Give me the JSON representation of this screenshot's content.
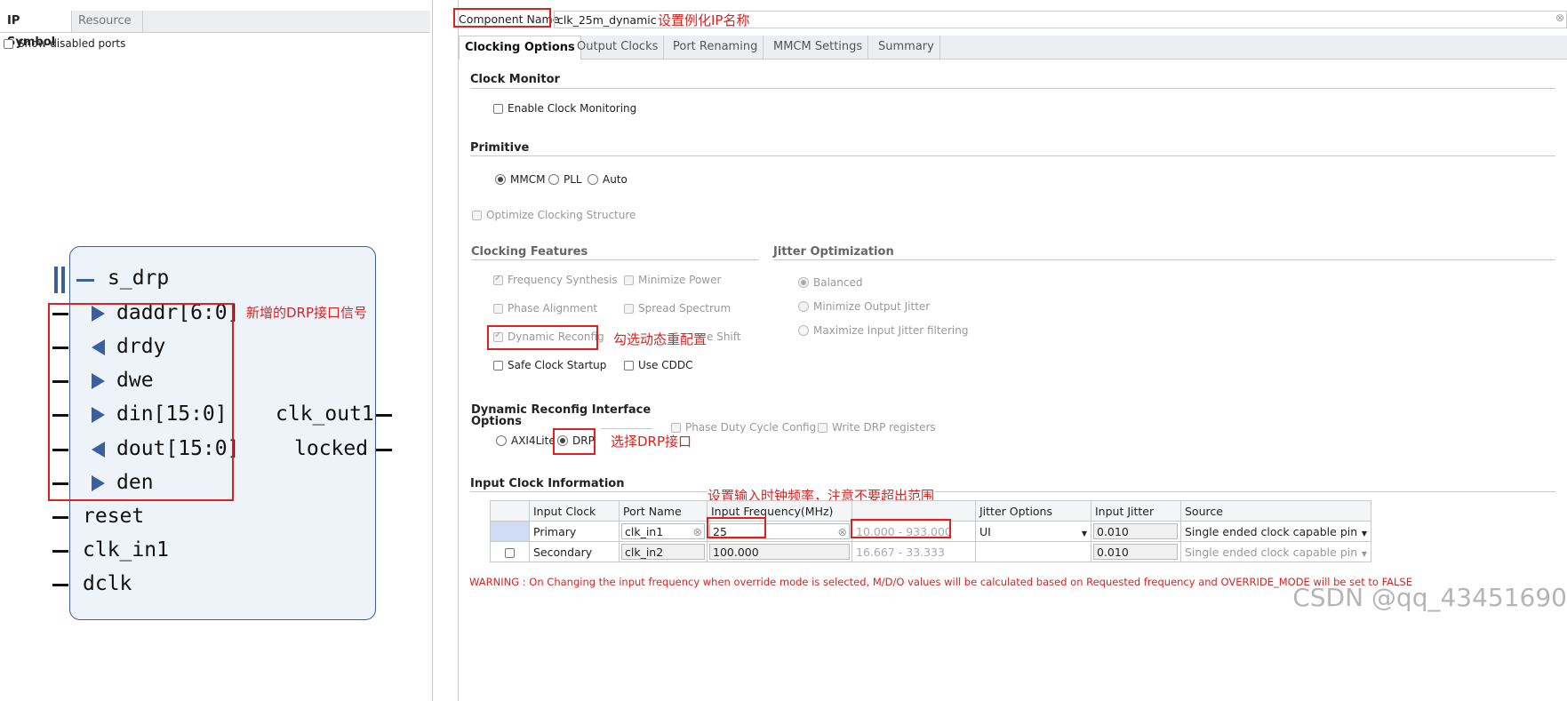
{
  "left_panel": {
    "tabs": [
      "IP Symbol",
      "Resource"
    ],
    "show_disabled_ports": "Show disabled ports",
    "symbol": {
      "bus_port": "s_drp",
      "input_ports": [
        "daddr[6:0]",
        "drdy",
        "dwe",
        "din[15:0]",
        "dout[15:0]",
        "den"
      ],
      "plain_ports": [
        "reset",
        "clk_in1",
        "dclk"
      ],
      "output_ports": [
        "clk_out1",
        "locked"
      ]
    },
    "annotation_drp_signals": "新增的DRP接口信号"
  },
  "component_name": {
    "label": "Component Name",
    "value": "clk_25m_dynamic",
    "annotation": "设置例化IP名称"
  },
  "tabs": [
    "Clocking Options",
    "Output Clocks",
    "Port Renaming",
    "MMCM Settings",
    "Summary"
  ],
  "clock_monitor": {
    "title": "Clock Monitor",
    "enable": "Enable Clock Monitoring"
  },
  "primitive": {
    "title": "Primitive",
    "options": [
      "MMCM",
      "PLL",
      "Auto"
    ],
    "selected": "MMCM",
    "optimize": "Optimize Clocking Structure"
  },
  "clocking_features": {
    "title": "Clocking Features",
    "items": [
      "Frequency Synthesis",
      "Minimize Power",
      "Phase Alignment",
      "Spread Spectrum",
      "Dynamic Reconfig",
      "e Shift",
      "Safe Clock Startup",
      "Use CDDC"
    ],
    "annotation": "勾选动态重配置"
  },
  "jitter_optimization": {
    "title": "Jitter Optimization",
    "options": [
      "Balanced",
      "Minimize Output Jitter",
      "Maximize Input Jitter filtering"
    ],
    "selected": "Balanced"
  },
  "dynamic_reconfig": {
    "title_line1": "Dynamic Reconfig Interface",
    "title_line2": "Options",
    "options": [
      "AXI4Lite",
      "DRP"
    ],
    "selected": "DRP",
    "phase_duty": "Phase Duty Cycle Config",
    "write_drp": "Write DRP registers",
    "annotation": "选择DRP接口"
  },
  "input_clock": {
    "title": "Input Clock Information",
    "annotation": "设置输入时钟频率，注意不要超出范围",
    "headers": [
      "Input Clock",
      "Port Name",
      "Input Frequency(MHz)",
      "",
      "Jitter Options",
      "Input Jitter",
      "Source"
    ],
    "rows": [
      {
        "clock": "Primary",
        "port": "clk_in1",
        "freq": "25",
        "range": "10.000 - 933.000",
        "jitter_opt": "UI",
        "jitter": "0.010",
        "source": "Single ended clock capable pin"
      },
      {
        "clock": "Secondary",
        "port": "clk_in2",
        "freq": "100.000",
        "range": "16.667 - 33.333",
        "jitter_opt": "",
        "jitter": "0.010",
        "source": "Single ended clock capable pin"
      }
    ]
  },
  "warning": "WARNING : On Changing the input frequency when override mode is selected, M/D/O values will be calculated based on Requested frequency and OVERRIDE_MODE will be set to FALSE",
  "watermark": "CSDN @qq_43451690",
  "colors": {
    "annotation_red": "#e0201e",
    "symbol_fill": "#eef3fa",
    "symbol_border": "#3a5fa0",
    "triangle": "#3a5fa0"
  }
}
